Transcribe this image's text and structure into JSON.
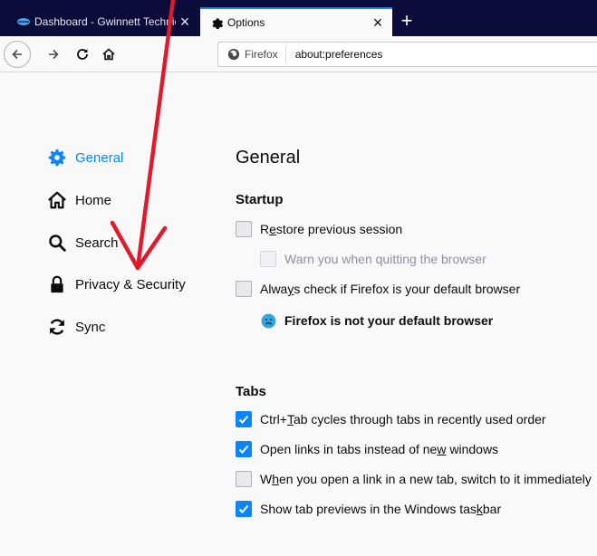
{
  "browser": {
    "tabs": [
      {
        "title": "Dashboard - Gwinnett Technical College",
        "active": false
      },
      {
        "title": "Options",
        "active": true
      }
    ],
    "identity_label": "Firefox",
    "url": "about:preferences"
  },
  "sidebar": {
    "items": [
      {
        "label": "General",
        "icon": "gear-icon",
        "selected": true
      },
      {
        "label": "Home",
        "icon": "home-icon",
        "selected": false
      },
      {
        "label": "Search",
        "icon": "search-icon",
        "selected": false
      },
      {
        "label": "Privacy & Security",
        "icon": "lock-icon",
        "selected": false
      },
      {
        "label": "Sync",
        "icon": "sync-icon",
        "selected": false
      }
    ]
  },
  "main": {
    "page_title": "General",
    "startup": {
      "title": "Startup",
      "restore_pre": "R",
      "restore_key": "e",
      "restore_post": "store previous session",
      "warn_label": "Warn you when quitting the browser",
      "default_pre": "Alwa",
      "default_key": "y",
      "default_post": "s check if Firefox is your default browser",
      "not_default_text": "Firefox is not your default browser"
    },
    "tabs": {
      "title": "Tabs",
      "ctrltab_pre": "Ctrl+",
      "ctrltab_key": "T",
      "ctrltab_post": "ab cycles through tabs in recently used order",
      "openlinks_pre": "Open links in tabs instead of ne",
      "openlinks_key": "w",
      "openlinks_post": " windows",
      "switch_pre": "W",
      "switch_key": "h",
      "switch_post": "en you open a link in a new tab, switch to it immediately",
      "previews_pre": "Show tab previews in the Windows tas",
      "previews_key": "k",
      "previews_post": "bar"
    }
  },
  "colors": {
    "accent": "#0a84ff",
    "tabstrip": "#0c0c3a",
    "annotation_arrow": "#e0192b"
  }
}
